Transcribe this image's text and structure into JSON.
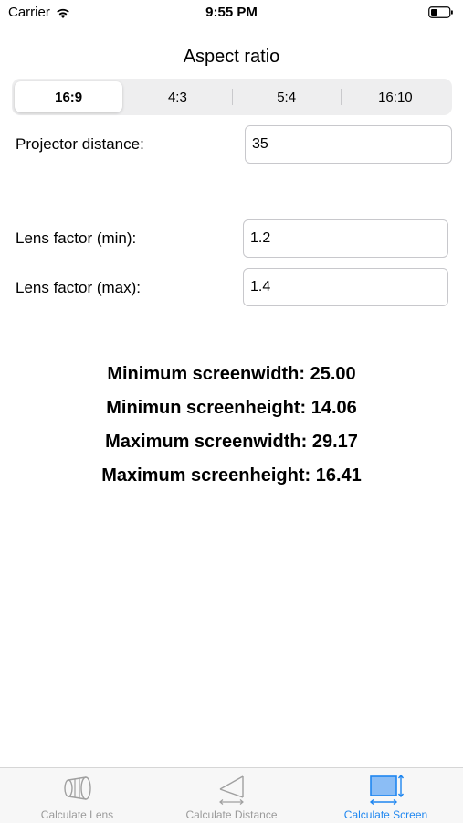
{
  "status_bar": {
    "carrier": "Carrier",
    "time": "9:55 PM"
  },
  "title": "Aspect ratio",
  "aspect_ratio": {
    "options": [
      "16:9",
      "4:3",
      "5:4",
      "16:10"
    ],
    "selected": "16:9"
  },
  "form": {
    "projector_distance": {
      "label": "Projector distance:",
      "value": "35"
    },
    "lens_factor_min": {
      "label": "Lens factor (min):",
      "value": "1.2"
    },
    "lens_factor_max": {
      "label": "Lens factor (max):",
      "value": "1.4"
    }
  },
  "results": [
    "Minimum screenwidth: 25.00",
    "Minimun screenheight: 14.06",
    "Maximum screenwidth: 29.17",
    "Maximum screenheight: 16.41"
  ],
  "tab_bar": {
    "tabs": [
      {
        "label": "Calculate Lens",
        "icon": "lens-icon"
      },
      {
        "label": "Calculate Distance",
        "icon": "distance-icon"
      },
      {
        "label": "Calculate Screen",
        "icon": "screen-icon"
      }
    ],
    "active_index": 2
  },
  "colors": {
    "accent": "#1e86f0",
    "inactive": "#9a9a9a"
  }
}
